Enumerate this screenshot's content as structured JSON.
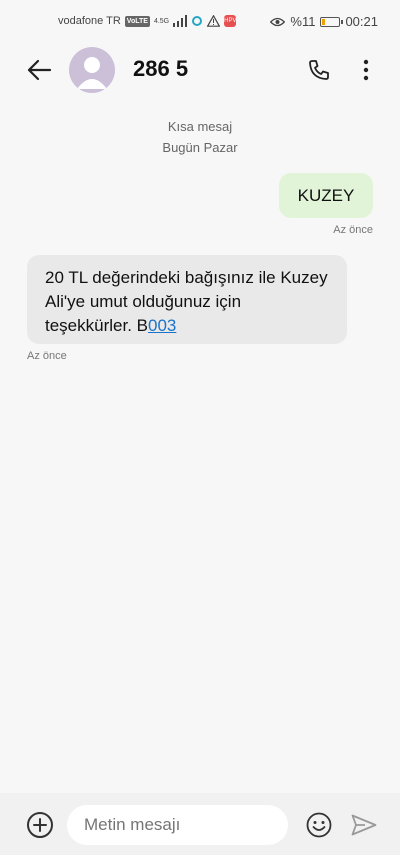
{
  "status_bar": {
    "carrier": "vodafone TR",
    "volte": "VoLTE",
    "network": "4.5G",
    "battery_text": "%11",
    "time": "00:21",
    "notif_badge": "HPV"
  },
  "header": {
    "contact_name": "286 5",
    "icons": [
      "back-arrow-icon",
      "avatar-icon",
      "phone-icon",
      "more-vert-icon"
    ]
  },
  "conversation": {
    "meta_type": "Kısa mesaj",
    "meta_day": "Bugün Pazar",
    "messages": [
      {
        "direction": "outgoing",
        "text": "KUZEY",
        "time": "Az önce"
      },
      {
        "direction": "incoming",
        "text_prefix": "20 TL değerindeki bağışınız ile Kuzey Ali'ye umut olduğunuz için teşekkürler. B",
        "link_text": "003",
        "time": "Az önce"
      }
    ]
  },
  "composer": {
    "placeholder": "Metin mesajı",
    "icons": [
      "add-icon",
      "emoji-icon",
      "send-icon"
    ]
  },
  "colors": {
    "background": "#f7f7f7",
    "outgoing_bubble": "#e2f4d8",
    "incoming_bubble": "#e9e9e9",
    "link": "#1a73c9"
  }
}
